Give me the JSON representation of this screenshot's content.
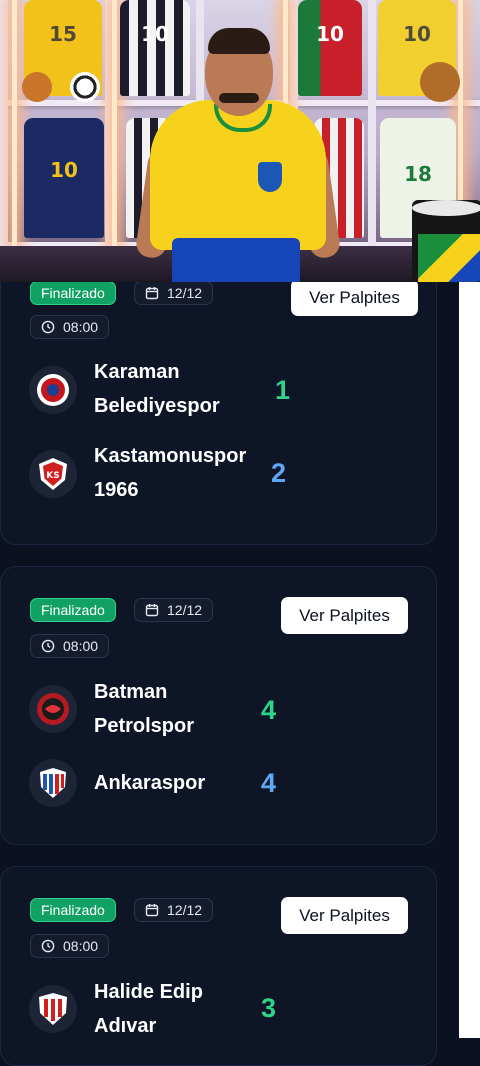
{
  "colors": {
    "background": "#0b1120",
    "card": "#0e1527",
    "status_green": "#12a165",
    "score_green": "#2fd48b",
    "score_blue": "#5fa8f5",
    "button_bg": "#ffffff"
  },
  "video": {
    "jersey_numbers": [
      "15",
      "10",
      "10",
      "10",
      "10",
      "18"
    ]
  },
  "matches": [
    {
      "status": "Finalizado",
      "date": "12/12",
      "time": "08:00",
      "button_label": "Ver Palpites",
      "home": {
        "name_line1": "Karaman",
        "name_line2": "Belediyespor",
        "score": "1"
      },
      "away": {
        "name_line1": "Kastamonuspor",
        "name_line2": "1966",
        "score": "2"
      }
    },
    {
      "status": "Finalizado",
      "date": "12/12",
      "time": "08:00",
      "button_label": "Ver Palpites",
      "home": {
        "name_line1": "Batman",
        "name_line2": "Petrolspor",
        "score": "4"
      },
      "away": {
        "name_line1": "Ankaraspor",
        "name_line2": "",
        "score": "4"
      }
    },
    {
      "status": "Finalizado",
      "date": "12/12",
      "time": "08:00",
      "button_label": "Ver Palpites",
      "home": {
        "name_line1": "Halide Edip",
        "name_line2": "Adıvar",
        "score": "3"
      }
    }
  ]
}
